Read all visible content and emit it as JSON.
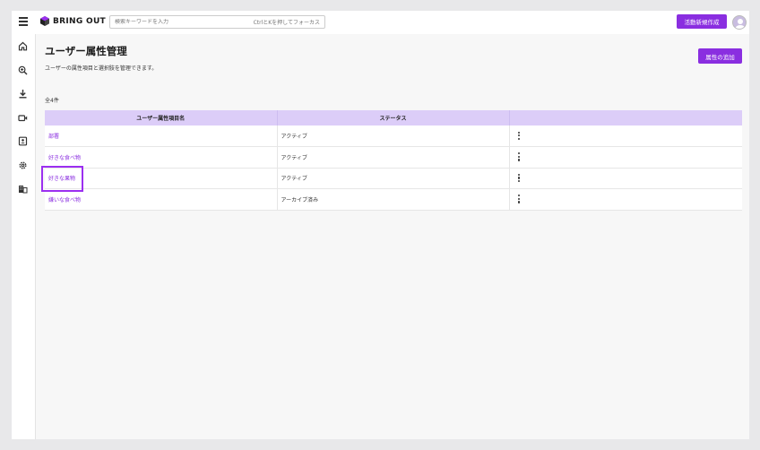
{
  "header": {
    "logo_text": "BRING OUT",
    "search_placeholder": "検索キーワードを入力",
    "search_shortcut_hint": "CtrlとKを押してフォーカス",
    "create_activity_label": "活動新規作成"
  },
  "sidebar": {
    "items": [
      {
        "icon": "home-icon"
      },
      {
        "icon": "search-zoom-icon"
      },
      {
        "icon": "download-icon"
      },
      {
        "icon": "video-icon"
      },
      {
        "icon": "contact-card-icon"
      },
      {
        "icon": "settings-gear-icon"
      },
      {
        "icon": "building-icon"
      }
    ]
  },
  "main": {
    "title": "ユーザー属性管理",
    "description": "ユーザーの属性項目と選択肢を管理できます。",
    "add_button_label": "属性の追加",
    "count_label": "全4件",
    "table": {
      "columns": [
        "ユーザー属性項目名",
        "ステータス",
        ""
      ],
      "rows": [
        {
          "name": "部署",
          "status": "アクティブ"
        },
        {
          "name": "好きな食べ物",
          "status": "アクティブ"
        },
        {
          "name": "好きな果物",
          "status": "アクティブ"
        },
        {
          "name": "嫌いな食べ物",
          "status": "アーカイブ済み"
        }
      ]
    }
  },
  "colors": {
    "accent": "#8a2ee0",
    "table_header_bg": "#dccdf8",
    "highlight": "#9b2ff0"
  }
}
